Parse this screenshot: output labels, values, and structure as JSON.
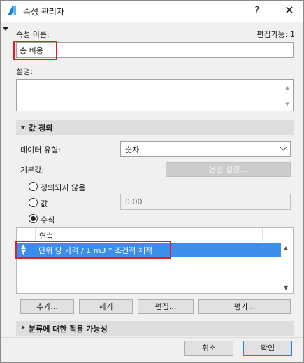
{
  "window": {
    "title": "속성 관리자",
    "help_label": "?",
    "close_label": "✕"
  },
  "property": {
    "name_label": "속성 이름:",
    "editable_status": "편집가능: 1",
    "name_value": "총 비용",
    "description_label": "설명:",
    "description_value": ""
  },
  "value_definition": {
    "section_title": "값 정의",
    "data_type_label": "데이터 유형:",
    "data_type_value": "숫자",
    "default_label": "기본값:",
    "options_button": "옵션 설정...",
    "radios": [
      {
        "label": "정의되지 않음",
        "selected": false
      },
      {
        "label": "값",
        "selected": false
      },
      {
        "label": "수식",
        "selected": true
      }
    ],
    "value_field": "0.00"
  },
  "formula_list": {
    "column_header": "연속",
    "rows": [
      {
        "text": "단위 당 가격 / 1 m3 * 조건적 체적",
        "selected": true
      }
    ],
    "buttons": {
      "add": "추가...",
      "remove": "제거",
      "edit": "편집...",
      "evaluate": "평가..."
    }
  },
  "classification": {
    "section_title": "분류에 대한 적용 가능성"
  },
  "footer": {
    "cancel": "취소",
    "ok": "확인"
  },
  "colors": {
    "accent": "#3b8fea",
    "highlight_box": "#e02020",
    "app_icon": "#1a7fd6"
  }
}
